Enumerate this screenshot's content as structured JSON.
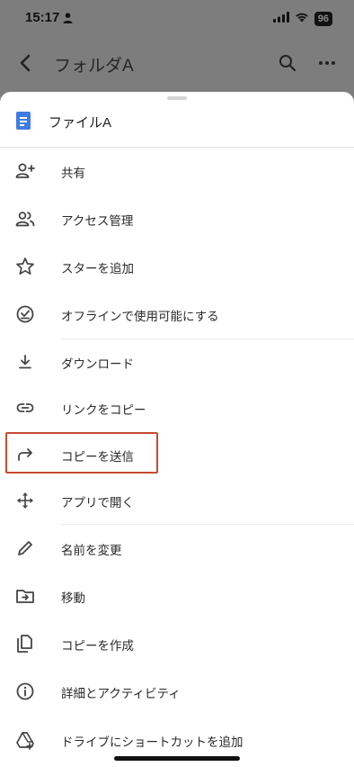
{
  "status_bar": {
    "time": "15:17",
    "battery": "96"
  },
  "app_bar": {
    "title": "フォルダA"
  },
  "sheet": {
    "file_name": "ファイルA",
    "items": [
      {
        "label": "共有",
        "icon": "person-add-icon"
      },
      {
        "label": "アクセス管理",
        "icon": "people-icon"
      },
      {
        "label": "スターを追加",
        "icon": "star-icon"
      },
      {
        "label": "オフラインで使用可能にする",
        "icon": "offline-check-icon"
      },
      {
        "label": "ダウンロード",
        "icon": "download-icon"
      },
      {
        "label": "リンクをコピー",
        "icon": "link-icon"
      },
      {
        "label": "コピーを送信",
        "icon": "share-arrow-icon"
      },
      {
        "label": "アプリで開く",
        "icon": "open-with-icon"
      },
      {
        "label": "名前を変更",
        "icon": "pencil-icon"
      },
      {
        "label": "移動",
        "icon": "move-folder-icon"
      },
      {
        "label": "コピーを作成",
        "icon": "file-copy-icon"
      },
      {
        "label": "詳細とアクティビティ",
        "icon": "info-icon"
      },
      {
        "label": "ドライブにショートカットを追加",
        "icon": "drive-shortcut-icon"
      }
    ]
  },
  "colors": {
    "doc_icon": "#3f7be0",
    "highlight_border": "#c84a33",
    "overlay": "#7d7d7d"
  }
}
